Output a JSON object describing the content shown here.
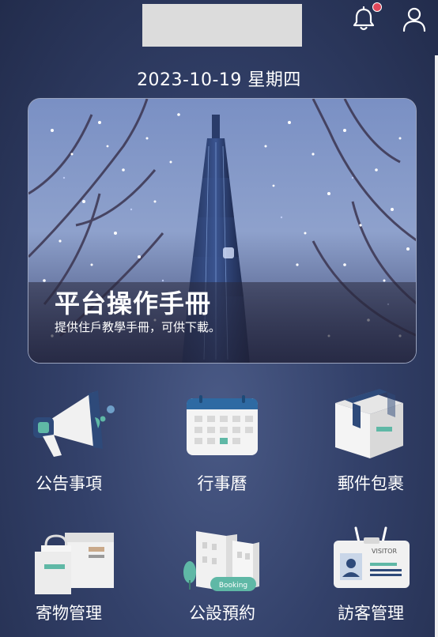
{
  "header": {
    "date": "2023-10-19 星期四",
    "bell_icon": "bell-icon",
    "user_icon": "user-icon",
    "notification_color": "#e0475a"
  },
  "banner": {
    "title": "平台操作手冊",
    "subtitle": "提供住戶教學手冊，可供下載。"
  },
  "menu": [
    {
      "label": "公告事項",
      "icon": "megaphone-icon"
    },
    {
      "label": "行事曆",
      "icon": "calendar-icon"
    },
    {
      "label": "郵件包裹",
      "icon": "package-icon"
    },
    {
      "label": "寄物管理",
      "icon": "storage-boxes-icon"
    },
    {
      "label": "公設預約",
      "icon": "booking-building-icon",
      "badge": "Booking"
    },
    {
      "label": "訪客管理",
      "icon": "visitor-badge-icon",
      "badge": "VISITOR"
    }
  ],
  "colors": {
    "background": "#33416a",
    "accent_teal": "#5fb8a6",
    "accent_navy": "#2e4a7a"
  }
}
